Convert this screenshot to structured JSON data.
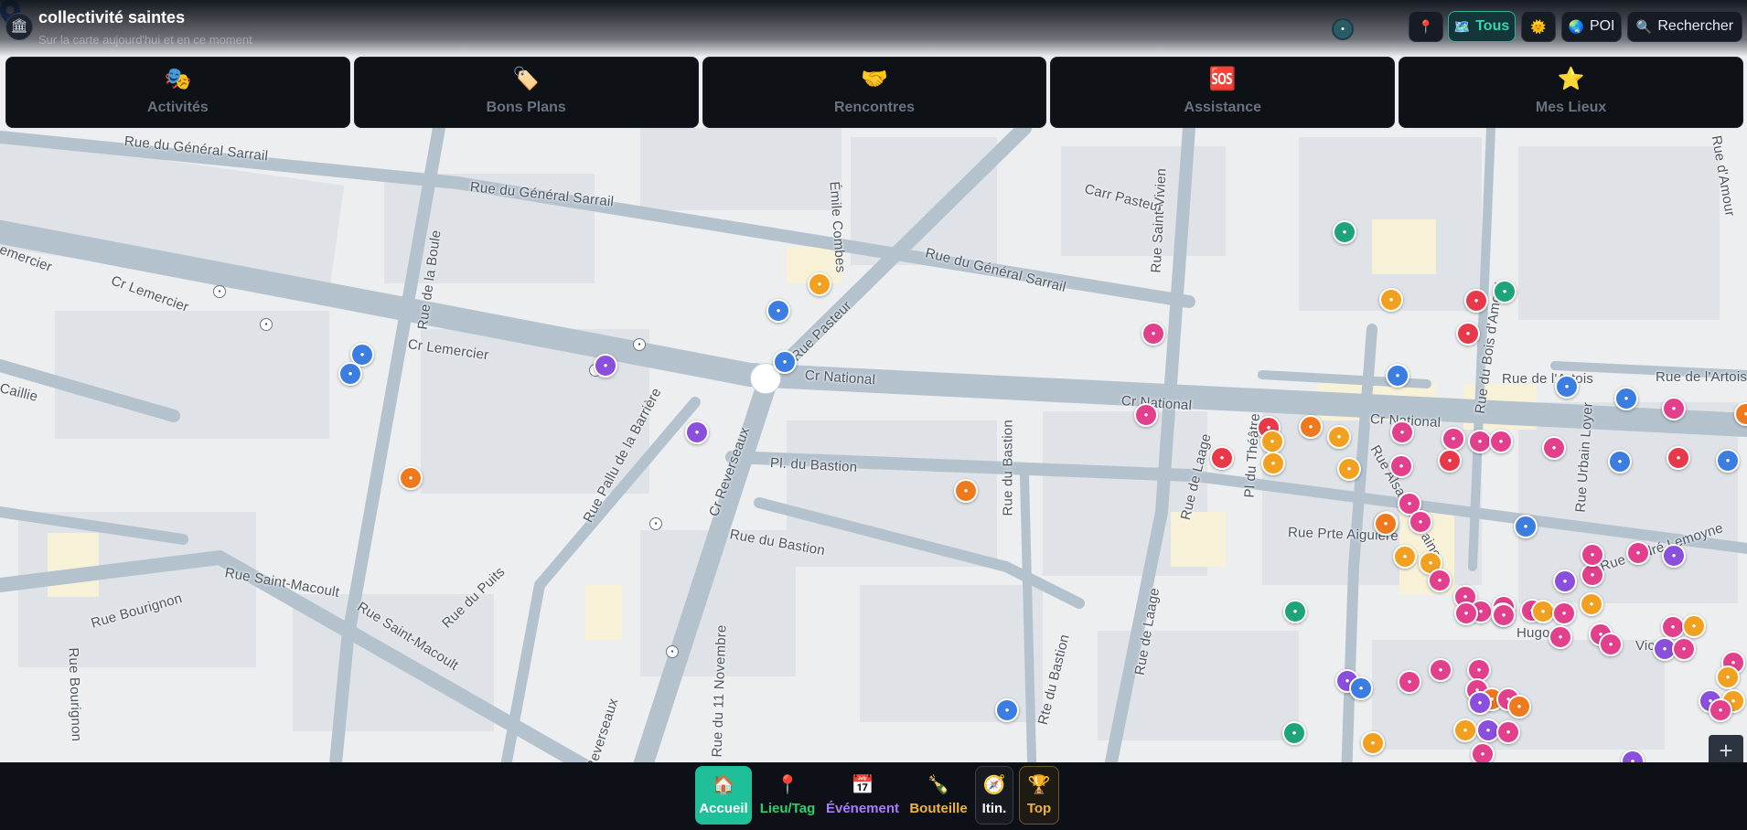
{
  "header": {
    "title": "collectivité saintes",
    "subtitle": "Sur la carte aujourd'hui et en ce moment",
    "logo_icon": "bank-icon"
  },
  "toolbar": {
    "pin_icon": "📍",
    "tous_icon": "🗺️",
    "tous_label": "Tous",
    "sun_icon": "🌞",
    "poi_icon": "🌏",
    "poi_label": "POI",
    "search_icon": "🔍",
    "search_label": "Rechercher"
  },
  "categories": [
    {
      "icon": "🎭",
      "label": "Activités"
    },
    {
      "icon": "🏷️",
      "label": "Bons Plans"
    },
    {
      "icon": "🤝",
      "label": "Rencontres"
    },
    {
      "icon": "🆘",
      "label": "Assistance"
    },
    {
      "icon": "⭐",
      "label": "Mes Lieux"
    }
  ],
  "bottom_nav": [
    {
      "icon": "🏠",
      "label": "Accueil",
      "color": "#ffffff"
    },
    {
      "icon": "📍",
      "label": "Lieu/Tag",
      "color": "#2bd16f"
    },
    {
      "icon": "📅",
      "label": "Événement",
      "color": "#a77cff"
    },
    {
      "icon": "🍾",
      "label": "Bouteille",
      "color": "#f2b339"
    },
    {
      "icon": "🧭",
      "label": "Itin.",
      "color": "#ffffff"
    },
    {
      "icon": "🏆",
      "label": "Top",
      "color": "#f2b339"
    }
  ],
  "map": {
    "streets": [
      "Rue du Général Sarrail",
      "Rue du Général Sarrail",
      "Rue du Général Sarrail",
      "emercier",
      "Cr Lemercier",
      "Cr Lemercier",
      "Cr National",
      "Cr National",
      "Cr National",
      "Rue Pasteur",
      "Émile Combes",
      "Carr Pasteur",
      "Rue Saint-Vivien",
      "Rue du Bois d'Amour",
      "Rue d'Amour",
      "Rue de l'Artois",
      "Rue de l'Artois",
      "Caillie",
      "Rue de la Boule",
      "Rue Pallu de la Barrière",
      "Cr Reverseaux",
      "Pl. du Bastion",
      "Rue du Bastion",
      "Rue du Bastion",
      "Rue de Laage",
      "Rue de Laage",
      "Rue Bourignon",
      "Rue Saint-Macoult",
      "Rue Saint-Macoult",
      "Rue du Puits",
      "Rue Bourignon",
      "Rue du 11 Novembre",
      "Reverseaux",
      "Rte du Bastion",
      "Rue Prte Aiguière",
      "Rue Alsace-Lorraine",
      "Rue Urbain Loyer",
      "Rue André Lemoyne",
      "Hugo",
      "Vic",
      "Pl du Théâtre"
    ]
  },
  "zoom": {
    "plus_label": "+"
  }
}
